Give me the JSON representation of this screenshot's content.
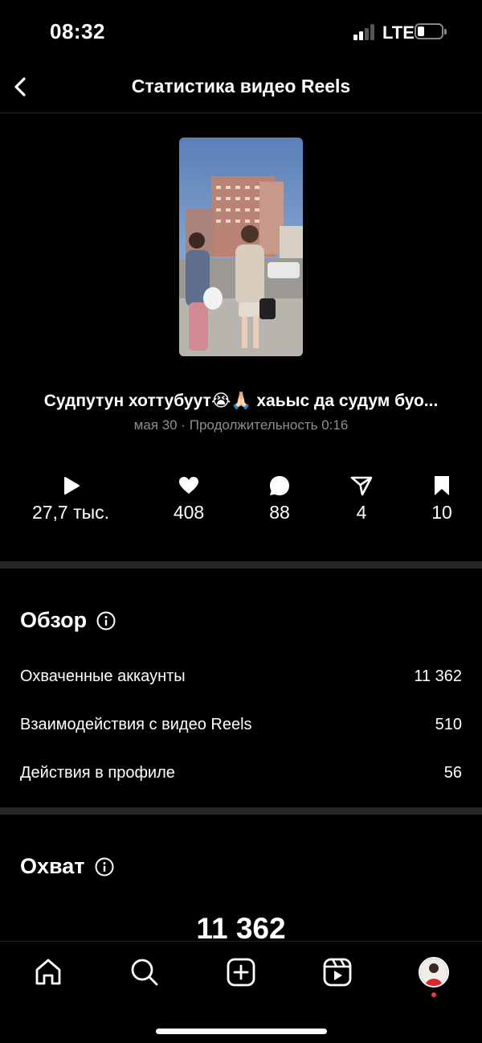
{
  "status_bar": {
    "time": "08:32",
    "network": "LTE"
  },
  "header": {
    "title": "Статистика видео Reels",
    "back_icon": "chevron-left-icon"
  },
  "reel": {
    "caption": "Судпутун хоттубуут😭🙏🏻 хаьыс да судум буо...",
    "meta": "мая 30 · Продолжительность 0:16"
  },
  "metrics": [
    {
      "icon": "play-icon",
      "value": "27,7 тыс."
    },
    {
      "icon": "heart-icon",
      "value": "408"
    },
    {
      "icon": "comment-icon",
      "value": "88"
    },
    {
      "icon": "share-icon",
      "value": "4"
    },
    {
      "icon": "bookmark-icon",
      "value": "10"
    }
  ],
  "overview": {
    "title": "Обзор",
    "rows": [
      {
        "label": "Охваченные аккаунты",
        "value": "11 362"
      },
      {
        "label": "Взаимодействия с видео Reels",
        "value": "510"
      },
      {
        "label": "Действия в профиле",
        "value": "56"
      }
    ]
  },
  "reach": {
    "title": "Охват",
    "value": "11 362"
  },
  "tabbar": {
    "items": [
      "home-icon",
      "search-icon",
      "create-icon",
      "reels-icon",
      "profile-avatar"
    ]
  },
  "colors": {
    "background": "#000000",
    "secondary_text": "#8e8e8e",
    "divider": "#262626",
    "notification": "#ff3040"
  }
}
